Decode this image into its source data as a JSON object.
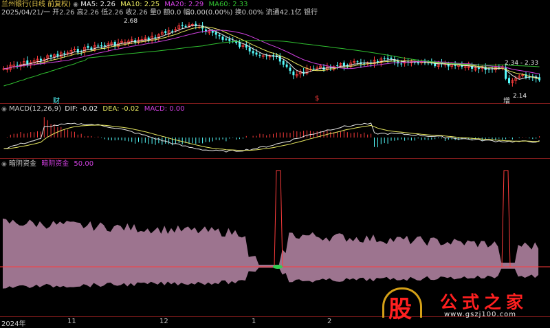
{
  "colors": {
    "up": "#ff3c3c",
    "down": "#54fcfc",
    "ma5": "#e8e8e8",
    "ma10": "#e8e860",
    "ma20": "#d040e0",
    "ma60": "#30c030",
    "dif": "#e8e8e8",
    "dea": "#e8e860",
    "macd": "#d040e0",
    "fund": "#b888a8",
    "separator": "#7a1a1a",
    "cursor": "#ff3c3c"
  },
  "chart1": {
    "stock_title": "兰州银行(日线 前复权)",
    "ma5_label": "MA5: 2.26",
    "ma10_label": "MA10: 2.25",
    "ma20_label": "MA20: 2.29",
    "ma60_label": "MA60: 2.33",
    "quote_line": "2025/04/21/一 开2.26 高2.26 低2.26 收2.26 量0 额0.0 幅0.00(0.00%) 换0.00% 流通42.1亿 银行",
    "high_label": "2.68",
    "recent_high_label": "2.34 - 2.33",
    "low_label": "2.14",
    "event_marks": [
      "财",
      "$",
      "增"
    ]
  },
  "chart2": {
    "indicator": "MACD(12,26,9)",
    "dif_label": "DIF: -0.02",
    "dea_label": "DEA: -0.02",
    "macd_label": "MACD: 0.00"
  },
  "chart3": {
    "indicator": "暗阴资金",
    "series_label": "暗阴资金",
    "series_value": "50.00"
  },
  "x_axis": {
    "labels": [
      "2024年",
      "11",
      "12",
      "1",
      "2"
    ]
  },
  "watermark": {
    "logo_text": "股",
    "site_name": "公式之家",
    "url": "www.gszj100.com"
  },
  "icons": [
    "circle-menu-icon"
  ]
}
